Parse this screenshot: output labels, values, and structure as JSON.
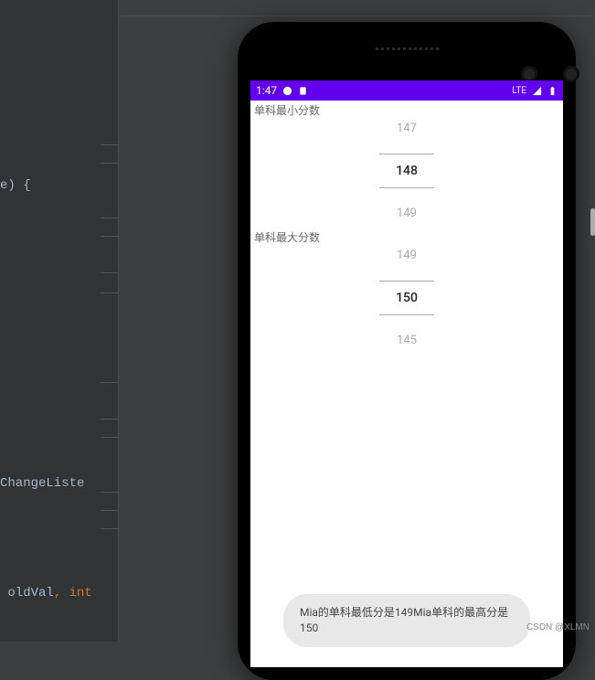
{
  "editor": {
    "line_paramlist": "e) {",
    "line_listener": "ChangeListe",
    "frag_oldval": " oldVal",
    "frag_comma": ", ",
    "frag_int": "int"
  },
  "status_bar": {
    "time": "1:47",
    "network": "LTE"
  },
  "screen": {
    "min_label": "单科最小分数",
    "max_label": "单科最大分数",
    "min_picker": {
      "above": "147",
      "selected": "148",
      "below": "149"
    },
    "max_picker": {
      "above": "149",
      "selected": "150",
      "below": "145"
    }
  },
  "toast": {
    "text": "Mia的单科最低分是149Mia单科的最高分是150"
  },
  "watermark": "CSDN @XLMN"
}
